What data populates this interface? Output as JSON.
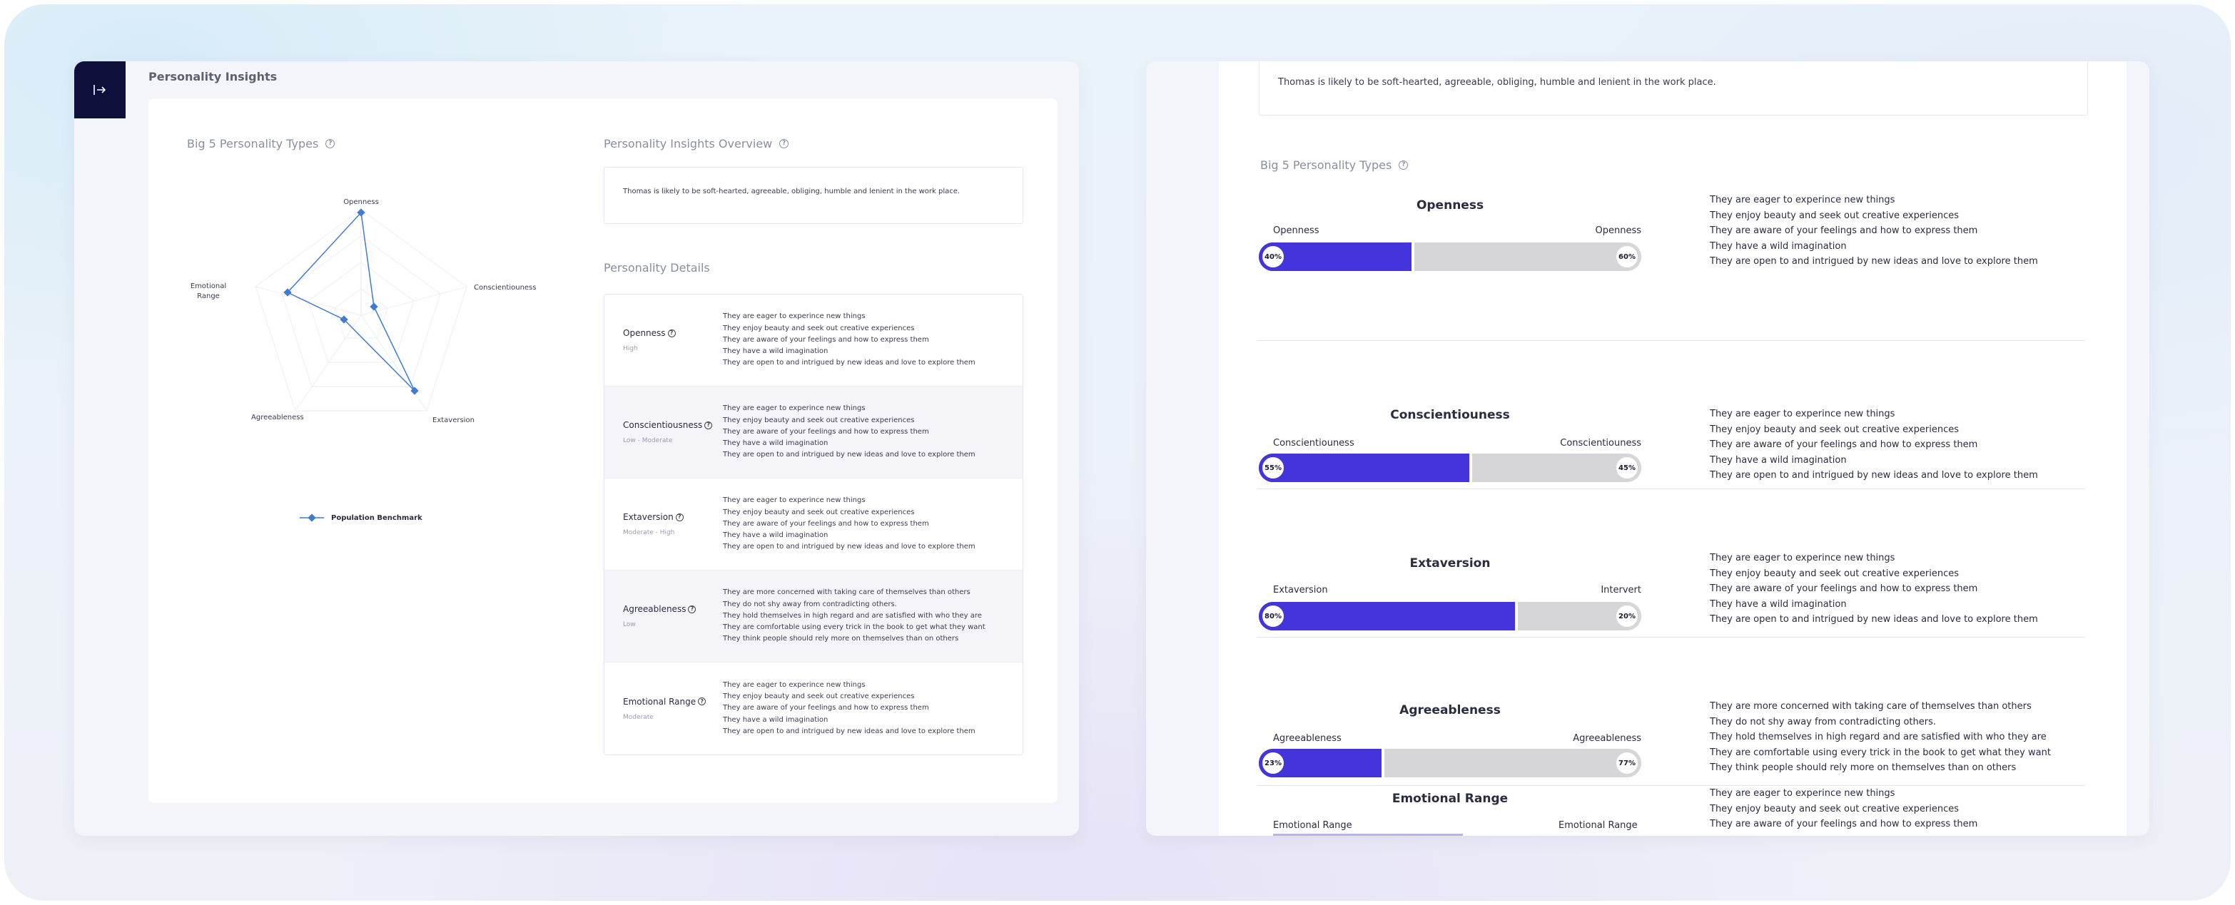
{
  "left": {
    "title": "Personality Insights",
    "exit_icon": "exit-arrow-icon",
    "big5_title": "Big 5 Personality Types",
    "overview_title": "Personality Insights Overview",
    "overview_text": "Thomas is likely to be soft-hearted, agreeable, obliging, humble and lenient in the work place.",
    "details_title": "Personality Details",
    "radar": {
      "axes": [
        "Openness",
        "Conscientiouness",
        "Extaversion",
        "Agreeableness",
        "Emotional Range"
      ],
      "emotional_line1": "Emotional",
      "emotional_line2": "Range",
      "legend": "Population Benchmark",
      "line_color": "#3f7bd1"
    },
    "details": [
      {
        "name": "Openness",
        "level": "High",
        "traits": [
          "They are eager to experince new things",
          "They enjoy beauty and seek out creative experiences",
          "They are aware of your feelings and how to express them",
          "They have a wild imagination",
          "They are open to and intrigued by new ideas and love to explore them"
        ]
      },
      {
        "name": "Conscientiousness",
        "level": "Low - Moderate",
        "traits": [
          "They are eager to experince new things",
          "They enjoy beauty and seek out creative experiences",
          "They are aware of your feelings and how to express them",
          "They have a wild imagination",
          "They are open to and intrigued by new ideas and love to explore them"
        ]
      },
      {
        "name": "Extaversion",
        "level": "Moderate - High",
        "traits": [
          "They are eager to experince new things",
          "They enjoy beauty and seek out creative experiences",
          "They are aware of your feelings and how to express them",
          "They have a wild imagination",
          "They are open to and intrigued by new ideas and love to explore them"
        ]
      },
      {
        "name": "Agreeableness",
        "level": "Low",
        "traits": [
          "They  are more concerned with taking care of themselves than others",
          "They do not shy away from contradicting others.",
          "They hold themselves in high regard and are satisfied with who they are",
          "They are comfortable using every trick in the book to get what they want",
          "They think people should rely more on themselves than on others"
        ]
      },
      {
        "name": "Emotional Range",
        "level": "Moderate",
        "traits": [
          "They are eager to experince new things",
          "They enjoy beauty and seek out creative experiences",
          "They are aware of your feelings and how to express them",
          "They have a wild imagination",
          "They are open to and intrigued by new ideas and love to explore them"
        ]
      }
    ]
  },
  "right": {
    "overview_text": "Thomas is likely to be soft-hearted, agreeable, obliging, humble and lenient in the work place.",
    "big5_title": "Big 5 Personality Types",
    "bar_color": "#4434dc",
    "bar_track_color": "#d6d6d9",
    "traits": [
      {
        "title": "Openness",
        "left_pole": "Openness",
        "right_pole": "Openness",
        "left_pct": "40%",
        "right_pct": "60%",
        "left_fraction": 0.4,
        "list": [
          "They are eager to experince new things",
          "They enjoy beauty and seek out creative experiences",
          "They are aware of your feelings and how to express them",
          "They have a wild imagination",
          "They are open to and intrigued by new ideas and love to explore them"
        ]
      },
      {
        "title": "Conscientiouness",
        "left_pole": "Conscientiouness",
        "right_pole": "Conscientiouness",
        "left_pct": "55%",
        "right_pct": "45%",
        "left_fraction": 0.55,
        "list": [
          "They are eager to experince new things",
          "They enjoy beauty and seek out creative experiences",
          "They are aware of your feelings and how to express them",
          "They have a wild imagination",
          "They are open to and intrigued by new ideas and love to explore them"
        ]
      },
      {
        "title": "Extaversion",
        "left_pole": "Extaversion",
        "right_pole": "Intervert",
        "left_pct": "80%",
        "right_pct": "20%",
        "left_fraction": 0.67,
        "list": [
          "They are eager to experince new things",
          "They enjoy beauty and seek out creative experiences",
          "They are aware of your feelings and how to express them",
          "They have a wild imagination",
          "They are open to and intrigued by new ideas and love to explore them"
        ]
      },
      {
        "title": "Agreeableness",
        "left_pole": "Agreeableness",
        "right_pole": "Agreeableness",
        "left_pct": "23%",
        "right_pct": "77%",
        "left_fraction": 0.32,
        "list": [
          "They  are more concerned with taking care of themselves than others",
          "They do not shy away from contradicting others.",
          "They hold themselves in high regard and are satisfied with who they are",
          "They are comfortable using every trick in the book to get what they want",
          "They think people should rely more on themselves than on others"
        ]
      },
      {
        "title": "Emotional Range",
        "left_pole": "Emotional Range",
        "right_pole": "Emotional Range",
        "list": [
          "They are eager to experince new things",
          "They enjoy beauty and seek out creative experiences",
          "They are aware of your feelings and how to express them"
        ]
      }
    ]
  }
}
